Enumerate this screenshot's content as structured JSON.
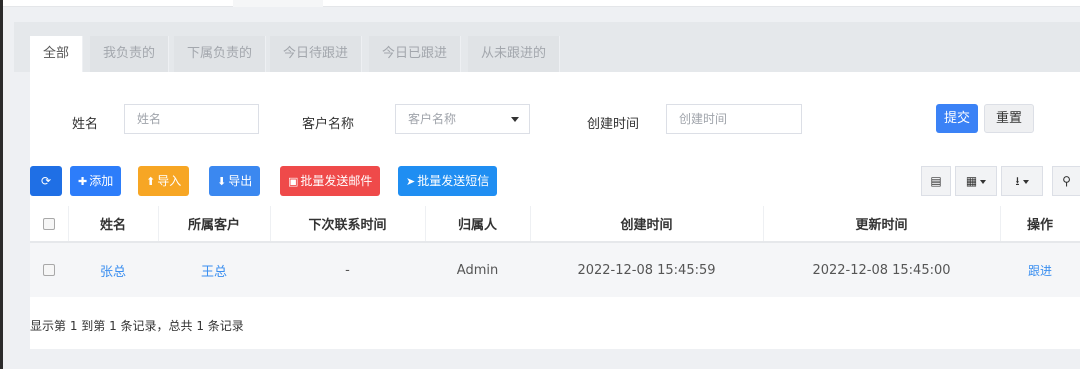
{
  "tabs": [
    {
      "label": "全部",
      "active": true
    },
    {
      "label": "我负责的",
      "active": false
    },
    {
      "label": "下属负责的",
      "active": false
    },
    {
      "label": "今日待跟进",
      "active": false
    },
    {
      "label": "今日已跟进",
      "active": false
    },
    {
      "label": "从未跟进的",
      "active": false
    }
  ],
  "filter": {
    "name_label": "姓名",
    "name_placeholder": "姓名",
    "customer_label": "客户名称",
    "customer_placeholder": "客户名称",
    "created_label": "创建时间",
    "created_placeholder": "创建时间",
    "submit_label": "提交",
    "reset_label": "重置"
  },
  "toolbar": {
    "refresh_icon": "refresh-icon",
    "add_label": "添加",
    "import_label": "导入",
    "export_label": "导出",
    "mail_label": "批量发送邮件",
    "sms_label": "批量发送短信",
    "right_icons": [
      "list-view-icon",
      "columns-icon",
      "export-menu-icon",
      "search-icon"
    ]
  },
  "table": {
    "headers": [
      "姓名",
      "所属客户",
      "下次联系时间",
      "归属人",
      "创建时间",
      "更新时间",
      "操作"
    ],
    "rows": [
      {
        "name": "张总",
        "customer": "王总",
        "next_contact": "-",
        "owner": "Admin",
        "created": "2022-12-08 15:45:59",
        "updated": "2022-12-08 15:45:00",
        "action": "跟进"
      }
    ]
  },
  "footer": {
    "summary": "显示第 1 到第 1 条记录，总共 1 条记录"
  },
  "colors": {
    "primary": "#2d7dfa",
    "warning": "#f7a624",
    "danger": "#ef4a4a",
    "link": "#3b8ff0"
  }
}
